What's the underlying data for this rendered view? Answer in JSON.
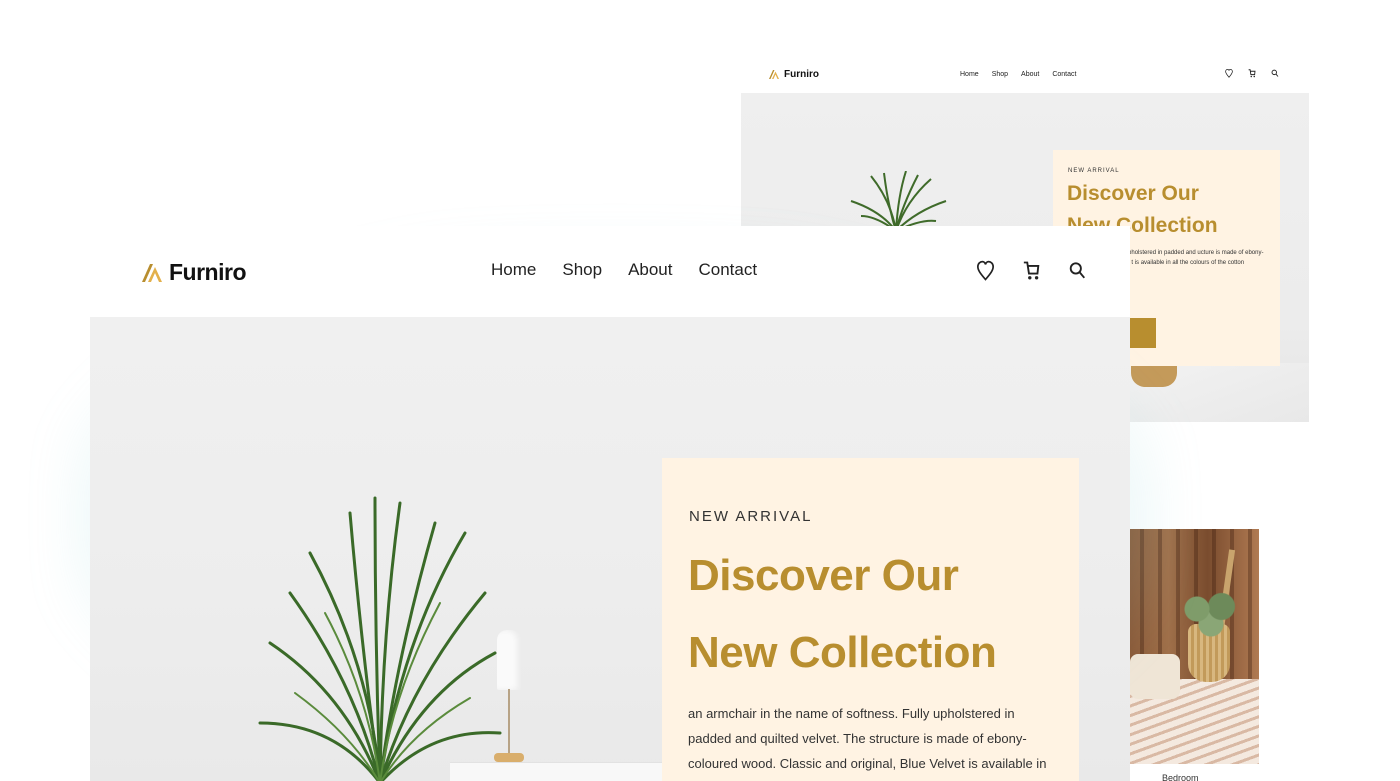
{
  "brand": {
    "name": "Furniro",
    "accent": "#b88e2f",
    "card_bg": "#fff3e3"
  },
  "nav": {
    "items": [
      "Home",
      "Shop",
      "About",
      "Contact"
    ]
  },
  "icons": [
    "heart-icon",
    "cart-icon",
    "search-icon"
  ],
  "hero": {
    "tag": "NEW ARRIVAL",
    "title_line1": "Discover Our",
    "title_line2": "New Collection",
    "description": "an armchair in the name of softness. Fully upholstered in padded and quilted velvet. The structure is made of ebony-coloured wood. Classic and original, Blue Velvet is available in all the colours of the cotton"
  },
  "preview": {
    "description": "me of softness. Fully upholstered in padded and ucture is made of ebony-coloured wood. Classic t is available in all the colours of the cotton"
  },
  "category": {
    "label": "Bedroom"
  }
}
